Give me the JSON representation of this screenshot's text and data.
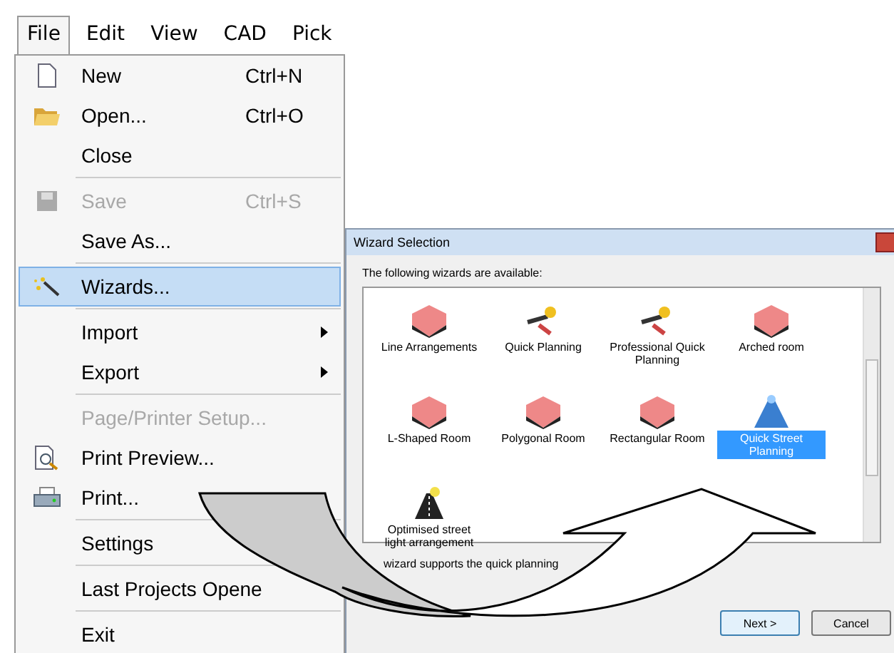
{
  "menu_bar": [
    {
      "label": "File",
      "selected": true
    },
    {
      "label": "Edit",
      "selected": false
    },
    {
      "label": "View",
      "selected": false
    },
    {
      "label": "CAD",
      "selected": false
    },
    {
      "label": "Pick",
      "selected": false
    }
  ],
  "file_menu": [
    {
      "kind": "item",
      "label": "New",
      "shortcut": "Ctrl+N",
      "disabled": false,
      "selected": false,
      "submenu": false
    },
    {
      "kind": "item",
      "label": "Open...",
      "shortcut": "Ctrl+O",
      "disabled": false,
      "selected": false,
      "submenu": false
    },
    {
      "kind": "item",
      "label": "Close",
      "disabled": false,
      "selected": false,
      "submenu": false
    },
    {
      "kind": "separator"
    },
    {
      "kind": "item",
      "label": "Save",
      "shortcut": "Ctrl+S",
      "disabled": true,
      "selected": false,
      "submenu": false
    },
    {
      "kind": "item",
      "label": "Save As...",
      "disabled": false,
      "selected": false,
      "submenu": false
    },
    {
      "kind": "separator"
    },
    {
      "kind": "item",
      "label": "Wizards...",
      "disabled": false,
      "selected": true,
      "submenu": false
    },
    {
      "kind": "separator"
    },
    {
      "kind": "item",
      "label": "Import",
      "disabled": false,
      "selected": false,
      "submenu": true
    },
    {
      "kind": "item",
      "label": "Export",
      "disabled": false,
      "selected": false,
      "submenu": true
    },
    {
      "kind": "separator"
    },
    {
      "kind": "item",
      "label": "Page/Printer Setup...",
      "disabled": true,
      "selected": false,
      "submenu": false
    },
    {
      "kind": "item",
      "label": "Print Preview...",
      "disabled": false,
      "selected": false,
      "submenu": false
    },
    {
      "kind": "item",
      "label": "Print...",
      "disabled": false,
      "selected": false,
      "submenu": false
    },
    {
      "kind": "separator"
    },
    {
      "kind": "item",
      "label": "Settings",
      "disabled": false,
      "selected": false,
      "submenu": false
    },
    {
      "kind": "separator"
    },
    {
      "kind": "item",
      "label": "Last Projects Opene",
      "disabled": false,
      "selected": false,
      "submenu": false
    },
    {
      "kind": "separator"
    },
    {
      "kind": "item",
      "label": "Exit",
      "disabled": false,
      "selected": false,
      "submenu": false
    }
  ],
  "dialog": {
    "title": "Wizard Selection",
    "prompt": "The following wizards are available:",
    "wizards": [
      {
        "label": "Line Arrangements",
        "selected": false
      },
      {
        "label": "Quick Planning",
        "selected": false
      },
      {
        "label": "Professional Quick Planning",
        "selected": false
      },
      {
        "label": "Arched room",
        "selected": false
      },
      {
        "label": "L-Shaped Room",
        "selected": false
      },
      {
        "label": "Polygonal Room",
        "selected": false
      },
      {
        "label": "Rectangular Room",
        "selected": false
      },
      {
        "label": "Quick Street Planning",
        "selected": true
      },
      {
        "label": "Optimised street light arrangement",
        "selected": false
      }
    ],
    "description": "wizard supports the quick planning",
    "buttons": [
      {
        "label": "Next >",
        "default": true
      },
      {
        "label": "Cancel",
        "default": false
      }
    ]
  }
}
